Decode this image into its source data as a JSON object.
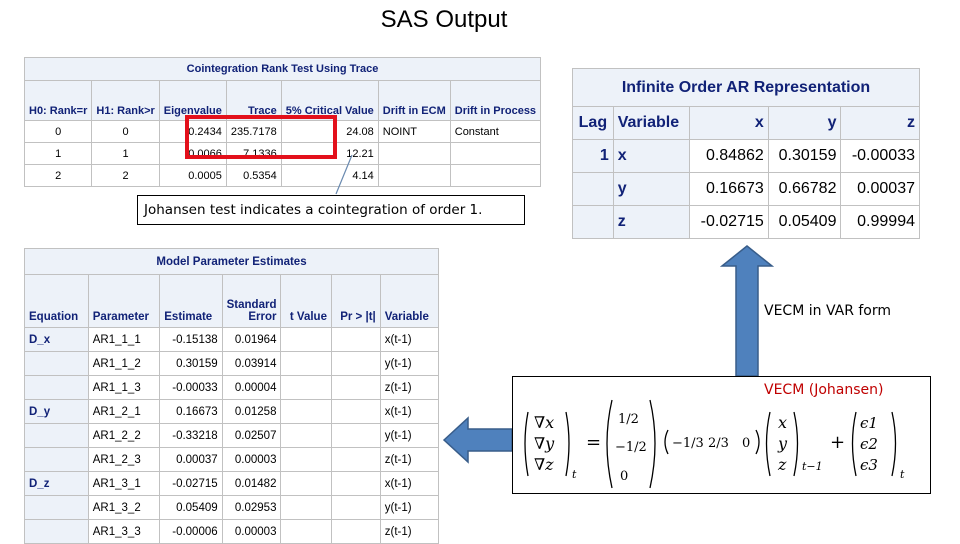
{
  "title": "SAS Output",
  "cointegration": {
    "caption": "Cointegration Rank Test Using Trace",
    "headers": [
      "H0: Rank=r",
      "H1: Rank>r",
      "Eigenvalue",
      "Trace",
      "5% Critical Value",
      "Drift in ECM",
      "Drift in Process"
    ],
    "rows": [
      [
        "0",
        "0",
        "0.2434",
        "235.7178",
        "24.08",
        "NOINT",
        "Constant"
      ],
      [
        "1",
        "1",
        "0.0066",
        "7.1336",
        "12.21",
        "",
        ""
      ],
      [
        "2",
        "2",
        "0.0005",
        "0.5354",
        "4.14",
        "",
        ""
      ]
    ]
  },
  "callout": {
    "text": "Johansen test indicates a cointegration of order 1."
  },
  "ar_representation": {
    "caption": "Infinite Order AR Representation",
    "headers": [
      "Lag",
      "Variable",
      "x",
      "y",
      "z"
    ],
    "rows": [
      [
        "1",
        "x",
        "0.84862",
        "0.30159",
        "-0.00033"
      ],
      [
        "",
        "y",
        "0.16673",
        "0.66782",
        "0.00037"
      ],
      [
        "",
        "z",
        "-0.02715",
        "0.05409",
        "0.99994"
      ]
    ]
  },
  "model_params": {
    "caption": "Model Parameter Estimates",
    "headers": [
      "Equation",
      "Parameter",
      "Estimate",
      "Standard Error",
      "t Value",
      "Pr > |t|",
      "Variable"
    ],
    "rows": [
      [
        "D_x",
        "AR1_1_1",
        "-0.15138",
        "0.01964",
        "",
        "",
        "x(t-1)"
      ],
      [
        "",
        "AR1_1_2",
        "0.30159",
        "0.03914",
        "",
        "",
        "y(t-1)"
      ],
      [
        "",
        "AR1_1_3",
        "-0.00033",
        "0.00004",
        "",
        "",
        "z(t-1)"
      ],
      [
        "D_y",
        "AR1_2_1",
        "0.16673",
        "0.01258",
        "",
        "",
        "x(t-1)"
      ],
      [
        "",
        "AR1_2_2",
        "-0.33218",
        "0.02507",
        "",
        "",
        "y(t-1)"
      ],
      [
        "",
        "AR1_2_3",
        "0.00037",
        "0.00003",
        "",
        "",
        "z(t-1)"
      ],
      [
        "D_z",
        "AR1_3_1",
        "-0.02715",
        "0.01482",
        "",
        "",
        "x(t-1)"
      ],
      [
        "",
        "AR1_3_2",
        "0.05409",
        "0.02953",
        "",
        "",
        "y(t-1)"
      ],
      [
        "",
        "AR1_3_3",
        "-0.00006",
        "0.00003",
        "",
        "",
        "z(t-1)"
      ]
    ]
  },
  "vecm_var_label": "VECM in VAR form",
  "vecm_title": "VECM (Johansen)",
  "equation": {
    "lhs": [
      "∇x",
      "∇y",
      "∇z"
    ],
    "lhs_sub": "t",
    "alpha": [
      "1/2",
      "−1/2",
      "0"
    ],
    "beta": [
      "−1/3",
      "2/3",
      "0"
    ],
    "vars": [
      "x",
      "y",
      "z"
    ],
    "vars_sub": "t−1",
    "eps": [
      "ϵ1",
      "ϵ2",
      "ϵ3"
    ],
    "eps_sub": "t"
  },
  "colors": {
    "header_bg": "#edf2f9",
    "header_text": "#112277",
    "highlight": "#e3101b",
    "arrow_fill": "#4f81bd",
    "arrow_stroke": "#385d8a",
    "vecm_title": "#c00000"
  }
}
